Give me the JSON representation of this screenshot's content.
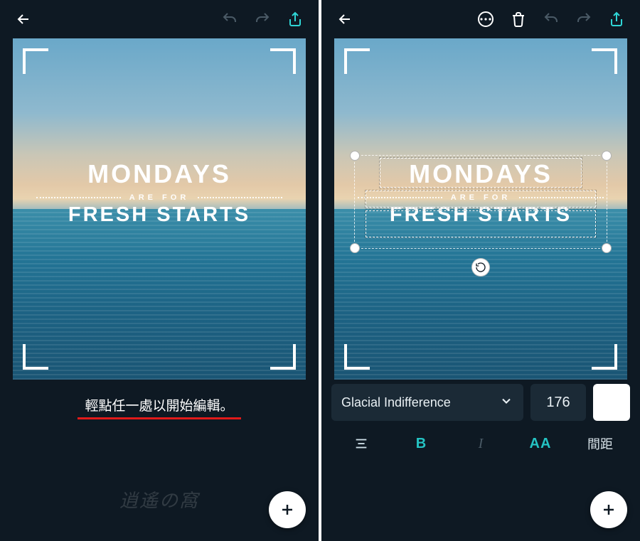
{
  "left": {
    "hint": "輕點任一處以開始編輯。",
    "poster": {
      "line1": "MONDAYS",
      "mid": "ARE FOR",
      "line2": "FRESH STARTS"
    }
  },
  "right": {
    "poster": {
      "line1": "MONDAYS",
      "mid": "ARE FOR",
      "line2": "FRESH STARTS"
    },
    "font_name": "Glacial Indifference",
    "font_size": "176",
    "bold_label": "B",
    "italic_label": "I",
    "caps_label": "AA",
    "spacing_label": "間距"
  }
}
